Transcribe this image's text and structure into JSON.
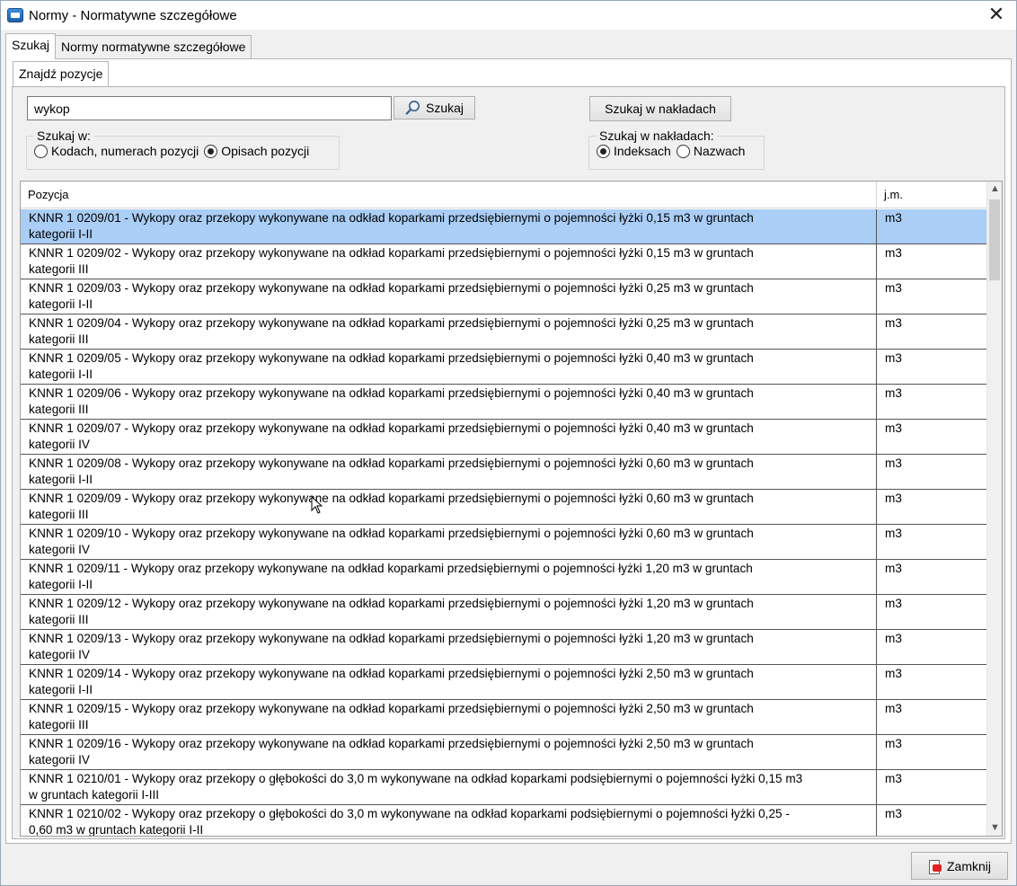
{
  "window": {
    "title": "Normy - Normatywne szczegółowe"
  },
  "tabs": [
    {
      "label": "Szukaj",
      "active": true
    },
    {
      "label": "Normy normatywne szczegółowe",
      "active": false
    }
  ],
  "subtab": {
    "label": "Znajdź pozycje"
  },
  "search": {
    "value": "wykop",
    "button_label": "Szukaj",
    "naklady_button_label": "Szukaj w nakładach"
  },
  "szukaj_w": {
    "legend": "Szukaj w:",
    "options": [
      {
        "label": "Kodach, numerach pozycji",
        "checked": false
      },
      {
        "label": "Opisach pozycji",
        "checked": true
      }
    ]
  },
  "szukaj_w_nakladach": {
    "legend": "Szukaj w nakładach:",
    "options": [
      {
        "label": "Indeksach",
        "checked": true
      },
      {
        "label": "Nazwach",
        "checked": false
      }
    ]
  },
  "grid": {
    "columns": [
      "Pozycja",
      "j.m."
    ],
    "rows": [
      {
        "l1": "KNNR 1 0209/01 - Wykopy oraz przekopy wykonywane na odkład koparkami przedsiębiernymi o pojemności łyżki 0,15 m3 w gruntach",
        "l2": "kategorii I-II",
        "jm": "m3",
        "selected": true
      },
      {
        "l1": "KNNR 1 0209/02 - Wykopy oraz przekopy wykonywane na odkład koparkami przedsiębiernymi o pojemności łyżki 0,15 m3 w gruntach",
        "l2": "kategorii III",
        "jm": "m3"
      },
      {
        "l1": "KNNR 1 0209/03 - Wykopy oraz przekopy wykonywane na odkład koparkami przedsiębiernymi o pojemności łyżki 0,25 m3 w gruntach",
        "l2": "kategorii I-II",
        "jm": "m3"
      },
      {
        "l1": "KNNR 1 0209/04 - Wykopy oraz przekopy wykonywane na odkład koparkami przedsiębiernymi o pojemności łyżki 0,25 m3 w gruntach",
        "l2": "kategorii III",
        "jm": "m3"
      },
      {
        "l1": "KNNR 1 0209/05 - Wykopy oraz przekopy wykonywane na odkład koparkami przedsiębiernymi o pojemności łyżki 0,40 m3 w gruntach",
        "l2": "kategorii I-II",
        "jm": "m3"
      },
      {
        "l1": "KNNR 1 0209/06 - Wykopy oraz przekopy wykonywane na odkład koparkami przedsiębiernymi o pojemności łyżki 0,40 m3 w gruntach",
        "l2": "kategorii III",
        "jm": "m3"
      },
      {
        "l1": "KNNR 1 0209/07 - Wykopy oraz przekopy wykonywane na odkład koparkami przedsiębiernymi o pojemności łyżki 0,40 m3 w gruntach",
        "l2": "kategorii IV",
        "jm": "m3"
      },
      {
        "l1": "KNNR 1 0209/08 - Wykopy oraz przekopy wykonywane na odkład koparkami przedsiębiernymi o pojemności łyżki 0,60 m3 w gruntach",
        "l2": "kategorii I-II",
        "jm": "m3"
      },
      {
        "l1": "KNNR 1 0209/09 - Wykopy oraz przekopy wykonywane na odkład koparkami przedsiębiernymi o pojemności łyżki 0,60 m3 w gruntach",
        "l2": "kategorii III",
        "jm": "m3"
      },
      {
        "l1": "KNNR 1 0209/10 - Wykopy oraz przekopy wykonywane na odkład koparkami przedsiębiernymi o pojemności łyżki 0,60 m3 w gruntach",
        "l2": "kategorii IV",
        "jm": "m3"
      },
      {
        "l1": "KNNR 1 0209/11 - Wykopy oraz przekopy wykonywane na odkład koparkami przedsiębiernymi o pojemności łyżki 1,20 m3 w gruntach",
        "l2": "kategorii I-II",
        "jm": "m3"
      },
      {
        "l1": "KNNR 1 0209/12 - Wykopy oraz przekopy wykonywane na odkład koparkami przedsiębiernymi o pojemności łyżki 1,20 m3 w gruntach",
        "l2": "kategorii III",
        "jm": "m3"
      },
      {
        "l1": "KNNR 1 0209/13 - Wykopy oraz przekopy wykonywane na odkład koparkami przedsiębiernymi o pojemności łyżki 1,20 m3 w gruntach",
        "l2": "kategorii IV",
        "jm": "m3"
      },
      {
        "l1": "KNNR 1 0209/14 - Wykopy oraz przekopy wykonywane na odkład koparkami przedsiębiernymi o pojemności łyżki 2,50 m3 w gruntach",
        "l2": "kategorii I-II",
        "jm": "m3"
      },
      {
        "l1": "KNNR 1 0209/15 - Wykopy oraz przekopy wykonywane na odkład koparkami przedsiębiernymi o pojemności łyżki 2,50 m3 w gruntach",
        "l2": "kategorii III",
        "jm": "m3"
      },
      {
        "l1": "KNNR 1 0209/16 - Wykopy oraz przekopy wykonywane na odkład koparkami przedsiębiernymi o pojemności łyżki 2,50 m3 w gruntach",
        "l2": "kategorii IV",
        "jm": "m3"
      },
      {
        "l1": "KNNR 1 0210/01 - Wykopy oraz przekopy o głębokości do 3,0 m wykonywane na odkład koparkami podsiębiernymi o pojemności łyżki 0,15 m3",
        "l2": "w gruntach kategorii I-III",
        "jm": "m3"
      },
      {
        "l1": "KNNR 1 0210/02 - Wykopy oraz przekopy o głębokości do 3,0 m wykonywane na odkład koparkami podsiębiernymi o pojemności łyżki 0,25 -",
        "l2": "0,60 m3 w gruntach kategorii I-II",
        "jm": "m3"
      }
    ]
  },
  "footer": {
    "close_label": "Zamknij"
  }
}
